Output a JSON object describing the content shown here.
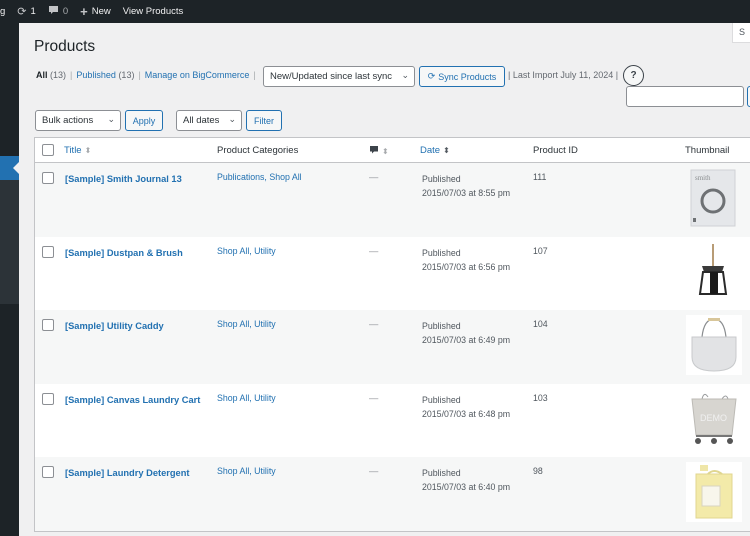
{
  "adminbar": {
    "site_fragment": "g",
    "updates_count": "1",
    "comments_count": "0",
    "new_label": "New",
    "view_label": "View Products"
  },
  "screen_options_label": "S",
  "page_title": "Products",
  "views": {
    "all_label": "All",
    "all_count": "(13)",
    "published_label": "Published",
    "published_count": "(13)",
    "manage_label": "Manage on BigCommerce"
  },
  "sync": {
    "select_value": "New/Updated since last sync",
    "button_label": "Sync Products",
    "last_import": "| Last Import July 11, 2024 |",
    "help_label": "?"
  },
  "search": {
    "placeholder": ""
  },
  "filters": {
    "bulk_actions": "Bulk actions",
    "apply_label": "Apply",
    "dates": "All dates",
    "filter_label": "Filter"
  },
  "table": {
    "columns": {
      "title": "Title",
      "categories": "Product Categories",
      "date": "Date",
      "product_id": "Product ID",
      "thumbnail": "Thumbnail"
    },
    "rows": [
      {
        "title": "[Sample] Smith Journal 13",
        "categories": "Publications, Shop All",
        "comments": "—",
        "status": "Published",
        "date": "2015/07/03 at 8:55 pm",
        "product_id": "111",
        "thumb": "journal"
      },
      {
        "title": "[Sample] Dustpan & Brush",
        "categories": "Shop All, Utility",
        "comments": "—",
        "status": "Published",
        "date": "2015/07/03 at 6:56 pm",
        "product_id": "107",
        "thumb": "dustpan"
      },
      {
        "title": "[Sample] Utility Caddy",
        "categories": "Shop All, Utility",
        "comments": "—",
        "status": "Published",
        "date": "2015/07/03 at 6:49 pm",
        "product_id": "104",
        "thumb": "caddy"
      },
      {
        "title": "[Sample] Canvas Laundry Cart",
        "categories": "Shop All, Utility",
        "comments": "—",
        "status": "Published",
        "date": "2015/07/03 at 6:48 pm",
        "product_id": "103",
        "thumb": "cart"
      },
      {
        "title": "[Sample] Laundry Detergent",
        "categories": "Shop All, Utility",
        "comments": "—",
        "status": "Published",
        "date": "2015/07/03 at 6:40 pm",
        "product_id": "98",
        "thumb": "detergent"
      }
    ]
  }
}
